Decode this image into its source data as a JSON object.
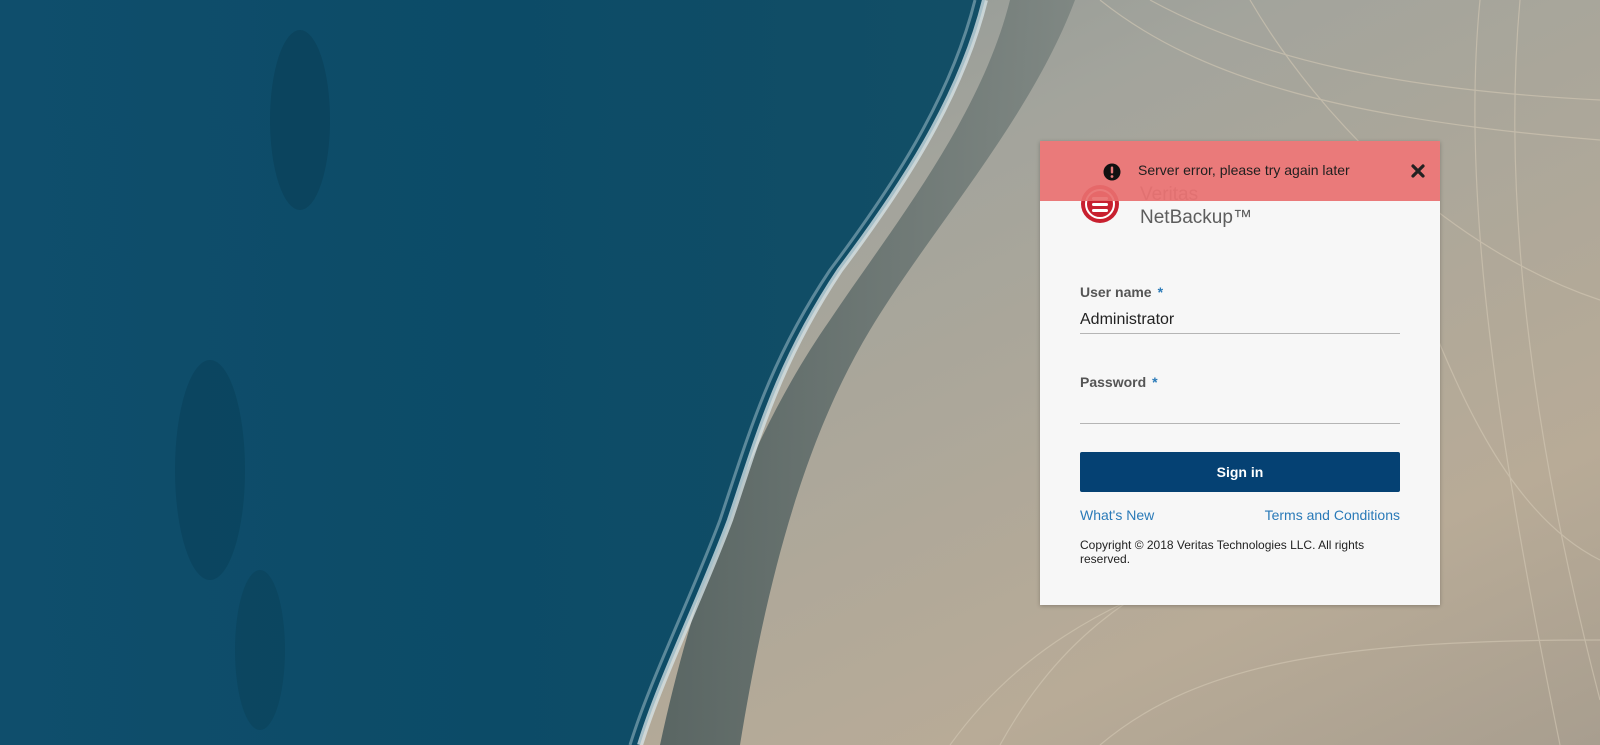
{
  "alert": {
    "message": "Server error, please try again later",
    "icon": "exclamation-circle-icon",
    "close_icon": "close-icon",
    "color": "#e86f6f"
  },
  "brand": {
    "line1": "Veritas",
    "line2": "NetBackup™",
    "logo_icon": "veritas-logo-icon",
    "logo_color": "#c8202f"
  },
  "form": {
    "username_label": "User name",
    "username_value": "Administrator",
    "password_label": "Password",
    "password_value": "",
    "required_mark": "*",
    "signin_label": "Sign in"
  },
  "links": {
    "whats_new": "What's New",
    "terms": "Terms and Conditions"
  },
  "footer": {
    "copyright": "Copyright © 2018 Veritas Technologies LLC. All rights reserved."
  },
  "colors": {
    "primary_button": "#054173",
    "link": "#2a7ab8",
    "card_bg": "#f7f7f7"
  }
}
